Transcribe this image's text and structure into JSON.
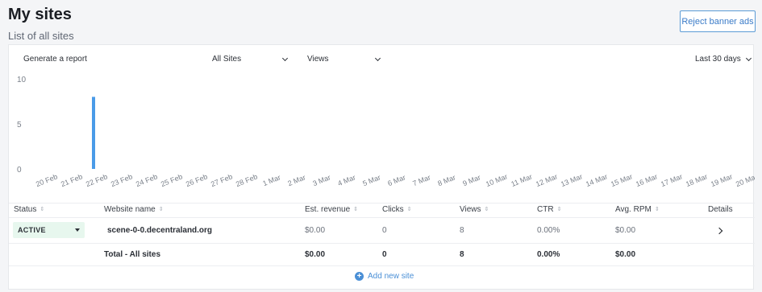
{
  "header": {
    "title": "My sites",
    "subtitle": "List of all sites",
    "reject_button": "Reject banner ads"
  },
  "toolbar": {
    "report_label": "Generate a report",
    "site_filter": "All Sites",
    "metric_filter": "Views",
    "range_filter": "Last 30 days"
  },
  "chart_data": {
    "type": "bar",
    "categories": [
      "20 Feb",
      "21 Feb",
      "22 Feb",
      "23 Feb",
      "24 Feb",
      "25 Feb",
      "26 Feb",
      "27 Feb",
      "28 Feb",
      "1 Mar",
      "2 Mar",
      "3 Mar",
      "4 Mar",
      "5 Mar",
      "6 Mar",
      "7 Mar",
      "8 Mar",
      "9 Mar",
      "10 Mar",
      "11 Mar",
      "12 Mar",
      "13 Mar",
      "14 Mar",
      "15 Mar",
      "16 Mar",
      "17 Mar",
      "18 Mar",
      "19 Mar",
      "20 Mar",
      "21 Mar",
      "22 Mar"
    ],
    "values": [
      0,
      8,
      0,
      0,
      0,
      0,
      0,
      0,
      0,
      0,
      0,
      0,
      0,
      0,
      0,
      0,
      0,
      0,
      0,
      0,
      0,
      0,
      0,
      0,
      0,
      0,
      0,
      0,
      0,
      0,
      0
    ],
    "yticks": [
      "0",
      "5",
      "10"
    ],
    "ylim": [
      0,
      10
    ],
    "grid": false,
    "color": "#4a9be8"
  },
  "table": {
    "headers": [
      "Status",
      "Website name",
      "Est. revenue",
      "Clicks",
      "Views",
      "CTR",
      "Avg. RPM",
      "Details"
    ],
    "row": {
      "status": "ACTIVE",
      "name": "scene-0-0.decentraland.org",
      "revenue": "$0.00",
      "clicks": "0",
      "views": "8",
      "ctr": "0.00%",
      "rpm": "$0.00"
    },
    "total": {
      "label": "Total - All sites",
      "revenue": "$0.00",
      "clicks": "0",
      "views": "8",
      "ctr": "0.00%",
      "rpm": "$0.00"
    }
  },
  "footer": {
    "add_site": "Add new site"
  }
}
